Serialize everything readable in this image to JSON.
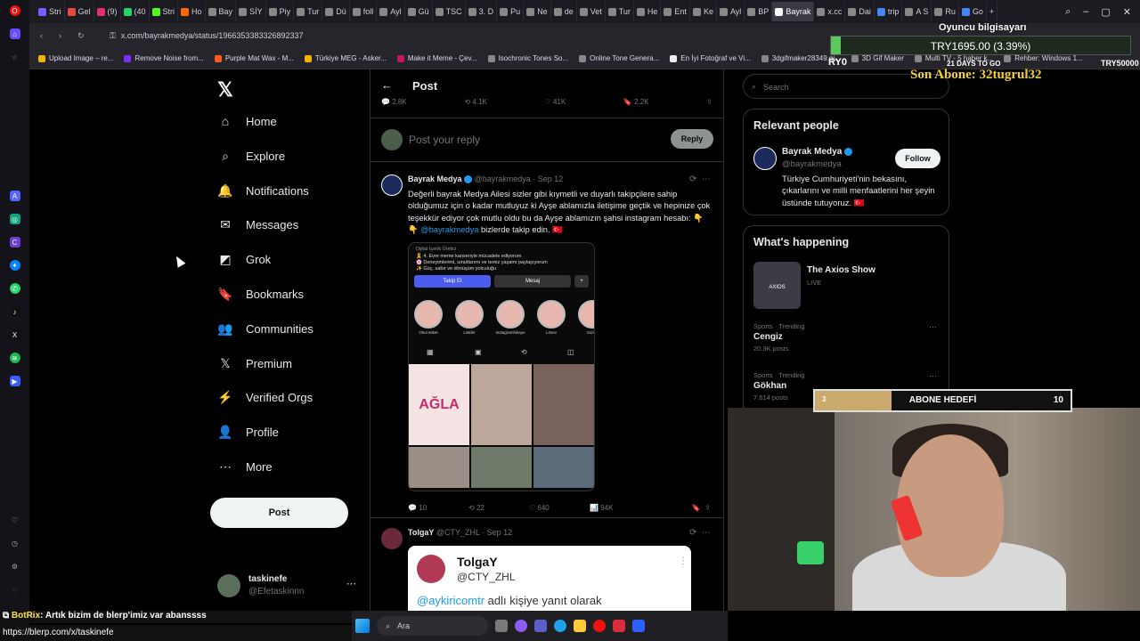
{
  "browser": {
    "tabs": [
      {
        "label": "Stri",
        "color": "#7b5cff"
      },
      {
        "label": "Gel",
        "color": "#e64a3c"
      },
      {
        "label": "(9)",
        "color": "#e1306c"
      },
      {
        "label": "(40",
        "color": "#25d366"
      },
      {
        "label": "Stri",
        "color": "#53fc18"
      },
      {
        "label": "Ho",
        "color": "#ff6a00"
      },
      {
        "label": "Bay",
        "color": "#888888"
      },
      {
        "label": "SİY",
        "color": "#888888"
      },
      {
        "label": "Piy",
        "color": "#888888"
      },
      {
        "label": "Tur",
        "color": "#888888"
      },
      {
        "label": "Dü",
        "color": "#888888"
      },
      {
        "label": "foll",
        "color": "#888888"
      },
      {
        "label": "Ayl",
        "color": "#888888"
      },
      {
        "label": "Gü",
        "color": "#888888"
      },
      {
        "label": "TSC",
        "color": "#888888"
      },
      {
        "label": "3. D",
        "color": "#888888"
      },
      {
        "label": "Pu",
        "color": "#888888"
      },
      {
        "label": "Ne",
        "color": "#888888"
      },
      {
        "label": "de",
        "color": "#888888"
      },
      {
        "label": "Vet",
        "color": "#888888"
      },
      {
        "label": "Tur",
        "color": "#888888"
      },
      {
        "label": "He",
        "color": "#888888"
      },
      {
        "label": "Ent",
        "color": "#888888"
      },
      {
        "label": "Ke",
        "color": "#888888"
      },
      {
        "label": "Ayl",
        "color": "#888888"
      },
      {
        "label": "BP",
        "color": "#888888"
      },
      {
        "label": "Bayrak",
        "color": "#ffffff",
        "active": true
      },
      {
        "label": "x.cc",
        "color": "#888888"
      },
      {
        "label": "Dai",
        "color": "#888888"
      },
      {
        "label": "trip",
        "color": "#4285f4"
      },
      {
        "label": "A S",
        "color": "#888888"
      },
      {
        "label": "Ru",
        "color": "#888888"
      },
      {
        "label": "Go",
        "color": "#4285f4"
      }
    ],
    "url": "x.com/bayrakmedya/status/1966353383326892337",
    "bookmarks": [
      {
        "label": "Upload Image – re...",
        "color": "#f5b400"
      },
      {
        "label": "Remove Noise from...",
        "color": "#7b2fff"
      },
      {
        "label": "Purple Mat Wax - M...",
        "color": "#ff5a1f"
      },
      {
        "label": "Türkiye MEG - Asker...",
        "color": "#f5b400"
      },
      {
        "label": "Make it Meme - Çev...",
        "color": "#c2185b"
      },
      {
        "label": "Isochronic Tones So...",
        "color": "#888888"
      },
      {
        "label": "Online Tone Genera...",
        "color": "#888888"
      },
      {
        "label": "En İyi Fotoğraf ve Vi...",
        "color": "#eeeeee"
      },
      {
        "label": "3dgifmaker28349.gi...",
        "color": "#888888"
      },
      {
        "label": "3D Gif Maker",
        "color": "#888888"
      },
      {
        "label": "Multi TV - 5 haber k...",
        "color": "#888888"
      },
      {
        "label": "Rehber: Windows 1...",
        "color": "#888888"
      }
    ]
  },
  "nav": {
    "items": [
      {
        "label": "Home",
        "icon": "⌂",
        "name": "home"
      },
      {
        "label": "Explore",
        "icon": "⌕",
        "name": "explore"
      },
      {
        "label": "Notifications",
        "icon": "🔔",
        "name": "notifications"
      },
      {
        "label": "Messages",
        "icon": "✉",
        "name": "messages"
      },
      {
        "label": "Grok",
        "icon": "◩",
        "name": "grok"
      },
      {
        "label": "Bookmarks",
        "icon": "🔖",
        "name": "bookmarks"
      },
      {
        "label": "Communities",
        "icon": "👥",
        "name": "communities"
      },
      {
        "label": "Premium",
        "icon": "𝕏",
        "name": "premium"
      },
      {
        "label": "Verified Orgs",
        "icon": "⚡",
        "name": "verified-orgs"
      },
      {
        "label": "Profile",
        "icon": "👤",
        "name": "profile"
      },
      {
        "label": "More",
        "icon": "⋯",
        "name": "more"
      }
    ],
    "post_label": "Post",
    "account_name": "taskinefe",
    "account_handle": "@Efetaskinnn"
  },
  "main": {
    "title": "Post",
    "counts": [
      "2.8K",
      "4.1K",
      "41K",
      "2.2K"
    ],
    "reply_placeholder": "Post your reply",
    "reply_button": "Reply",
    "tweet1": {
      "name": "Bayrak Medya",
      "handle": "@bayrakmedya · Sep 12",
      "text": "Değerli bayrak Medya Ailesi sizler gibi kıymetli ve duyarlı takipçilere sahip olduğumuz için o kadar mutluyuz ki Ayşe ablamızla iletişime geçtik ve hepinize çok teşekkür ediyor çok mutlu oldu bu da Ayşe ablamızın şahsi instagram hesabı: 👇👇",
      "mention": "@bayrakmedya",
      "text_end": "bizlerde takip edin. 🇹🇷",
      "shot": {
        "label": "Dijital İçerik Üretici",
        "bio": [
          "🎗️ 4. Evre meme kanseriyle mücadele ediyorum",
          "🌸 Deneyimlerimi, umutlarımı ve temiz yaşamı paylaşıyorum",
          "✨ Güç, sabır ve dönüşüm yolculuğu"
        ],
        "follow": "Takip Et",
        "message": "Mesaj",
        "highlights": [
          "Okul etiket",
          "Linkler",
          "Instagramhikaye",
          "Lösev",
          "Soru -"
        ],
        "grid_text": "AĞLA"
      },
      "actions": [
        "10",
        "22",
        "640",
        "94K"
      ]
    },
    "tweet2": {
      "name": "TolgaY",
      "handle": "@CTY_ZHL · Sep 12",
      "quote_name": "TolgaY",
      "quote_handle": "@CTY_ZHL",
      "quote_mention": "@aykiricomtr",
      "quote_text": "adlı kişiye yanıt olarak"
    }
  },
  "sidebar": {
    "search_placeholder": "Search",
    "relevant_title": "Relevant people",
    "person_name": "Bayrak Medya",
    "person_handle": "@bayrakmedya",
    "follow": "Follow",
    "bio": "Türkiye Cumhuriyeti'nin bekasını, çıkarlarını ve milli menfaatlerini her şeyin üstünde tutuyoruz. 🇹🇷",
    "happening_title": "What's happening",
    "show": "The Axios Show",
    "show_status": "LIVE",
    "show_thumb": "AXIOS",
    "trends": [
      {
        "category": "Sports · Trending",
        "title": "Cengiz",
        "posts": "20.3K posts"
      },
      {
        "category": "Sports · Trending",
        "title": "Gökhan",
        "posts": "7,614 posts"
      }
    ]
  },
  "stream": {
    "goal_current": "3",
    "goal_label": "ABONE HEDEFİ",
    "goal_target": "10",
    "goal_progress": 0.3,
    "overlay_title": "Oyuncu bilgisayarı",
    "overlay_amount": "TRY1695.00 (3.39%)",
    "overlay_progress": 0.0339,
    "overlay_left": "RY0",
    "overlay_mid": "21 DAYS TO GO",
    "overlay_right": "TRY50000",
    "last_sub": "Son Abone: 32tugrul32",
    "bot_name": "BotRix",
    "bot_message": ": Artık bizim de blerp'imiz var abanssss",
    "bot_link": "https://blerp.com/x/taskinefe",
    "taskbar_search": "Ara"
  }
}
